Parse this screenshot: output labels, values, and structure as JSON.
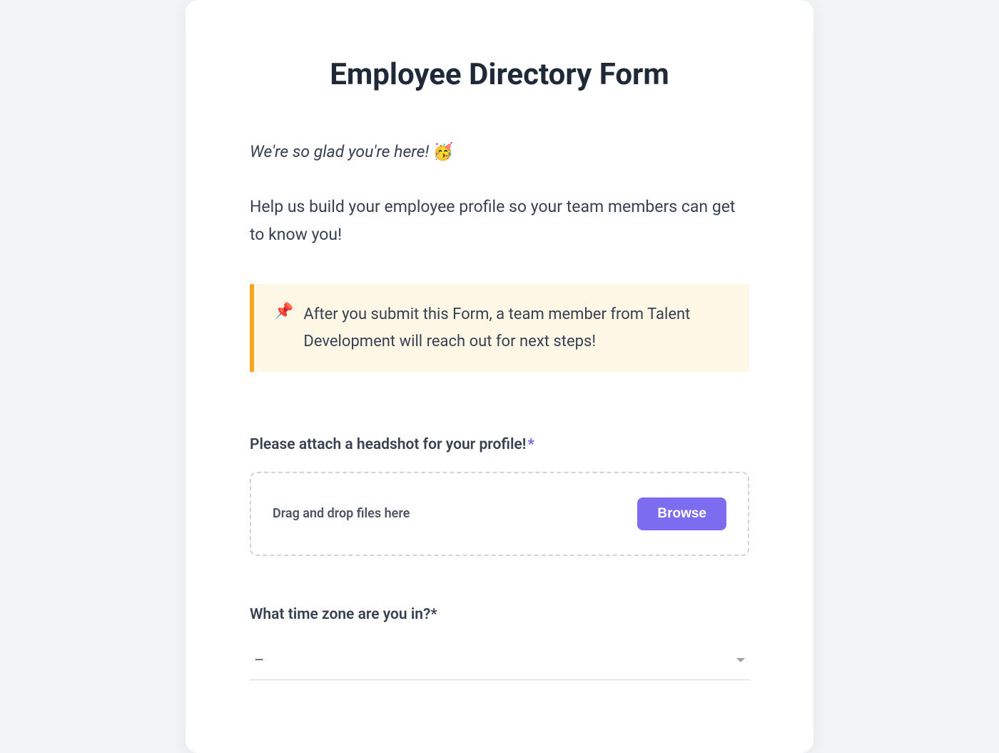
{
  "form": {
    "title": "Employee Directory Form",
    "intro_text": "We're so glad you're here! ",
    "intro_emoji": "🥳",
    "description": "Help us build your employee profile so your team members can get to know you!",
    "callout": {
      "icon": "📌",
      "text": "After you submit this Form, a team member from Talent Development will reach out for next steps!"
    },
    "fields": {
      "headshot": {
        "label": "Please attach a headshot for your profile!",
        "required_marker": "*",
        "dropzone_text": "Drag and drop files here",
        "browse_label": "Browse"
      },
      "timezone": {
        "label": "What time zone are you in?",
        "required_marker": "*",
        "selected_value": "–"
      }
    }
  }
}
